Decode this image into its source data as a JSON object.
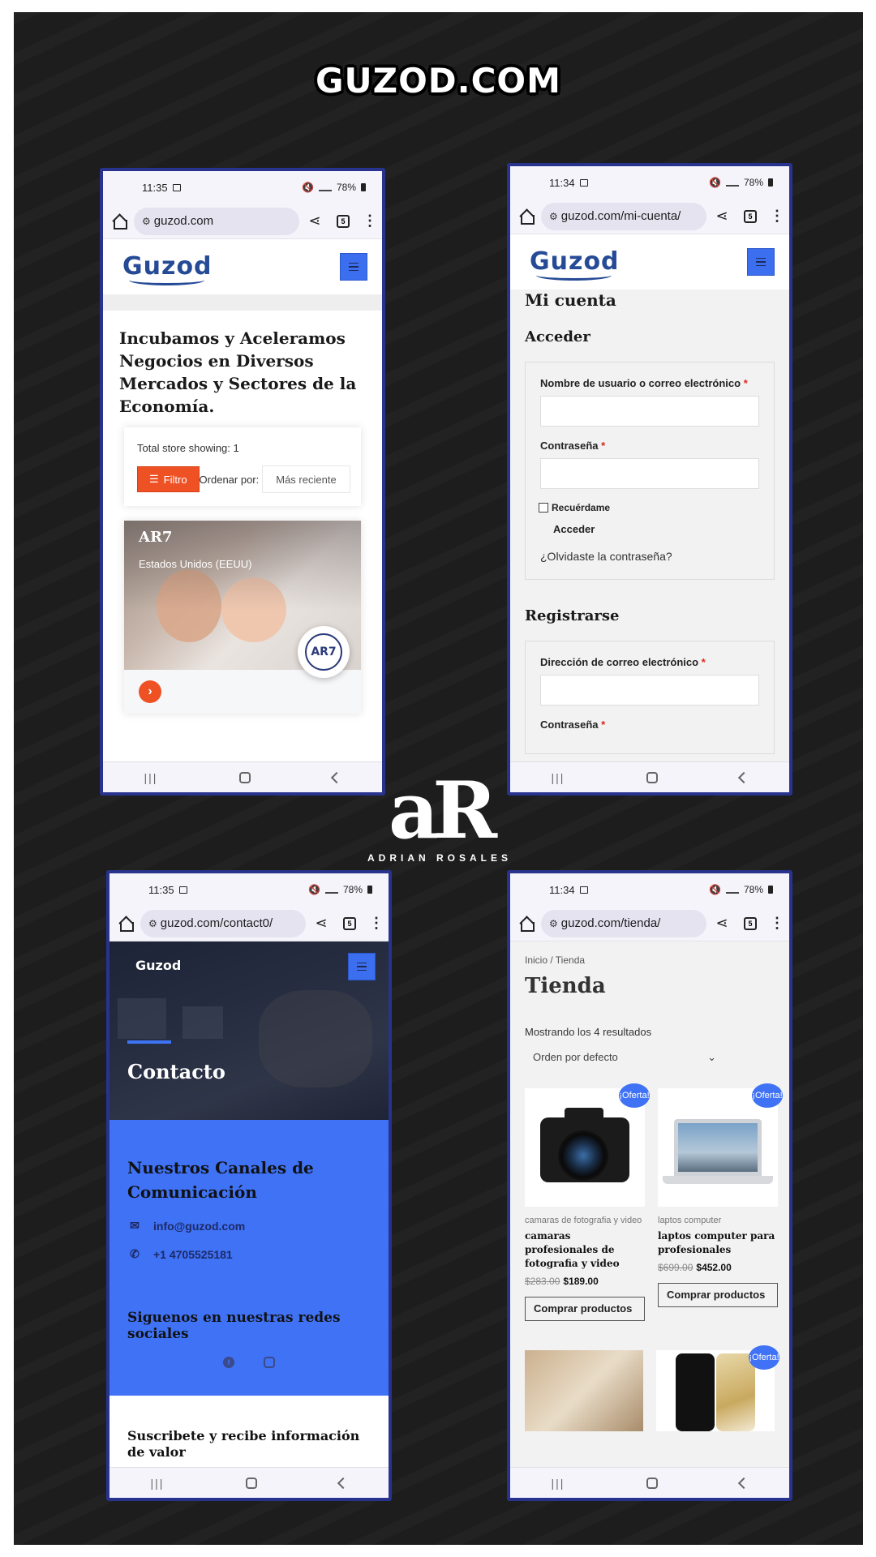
{
  "site_logo": "GUZOD.COM",
  "author_logo": {
    "mark": "aR",
    "name": "ADRIAN ROSALES"
  },
  "brand_name": "Guzod",
  "colors": {
    "background": "#1d1d1d",
    "frame": "#27338c",
    "accent_blue": "#3f72f5",
    "accent_orange": "#ee5124"
  },
  "phones": {
    "home": {
      "time": "11:35",
      "battery": "78%",
      "url": "guzod.com",
      "tab_count": "5",
      "hero_title": "Incubamos y Aceleramos Negocios en Diversos Mercados y Sectores de la Economía.",
      "store_count": "Total store showing: 1",
      "filter_label": "Filtro",
      "order_label": "Ordenar por:",
      "order_value": "Más reciente",
      "store_name": "AR7",
      "store_location": "Estados Unidos (EEUU)",
      "store_badge": "AR7"
    },
    "account": {
      "time": "11:34",
      "battery": "78%",
      "url": "guzod.com/mi-cuenta/",
      "tab_count": "5",
      "page_title": "Mi cuenta",
      "login_heading": "Acceder",
      "username_label": "Nombre de usuario o correo electrónico",
      "password_label": "Contraseña",
      "required_mark": "*",
      "remember_label": "Recuérdame",
      "login_button": "Acceder",
      "forgot_link": "¿Olvidaste la contraseña?",
      "register_heading": "Registrarse",
      "email_label": "Dirección de correo electrónico",
      "password_label_2": "Contraseña"
    },
    "contact": {
      "time": "11:35",
      "battery": "78%",
      "url": "guzod.com/contact0/",
      "tab_count": "5",
      "hero_title": "Contacto",
      "channels_heading": "Nuestros Canales de Comunicación",
      "email": "info@guzod.com",
      "phone": "+1 4705525181",
      "social_heading": "Siguenos en nuestras redes sociales",
      "subscribe_heading": "Suscribete y recibe información de valor"
    },
    "shop": {
      "time": "11:34",
      "battery": "78%",
      "url": "guzod.com/tienda/",
      "tab_count": "5",
      "breadcrumb": "Inicio / Tienda",
      "page_title": "Tienda",
      "results": "Mostrando los 4 resultados",
      "sort": "Orden por defecto",
      "sale_badge": "¡Oferta!",
      "products": [
        {
          "category": "camaras de fotografia y video",
          "name": "camaras profesionales de fotografia y video",
          "old_price": "$283.00",
          "price": "$189.00",
          "button": "Comprar productos"
        },
        {
          "category": "laptos computer",
          "name": "laptos computer para profesionales",
          "old_price": "$699.00",
          "price": "$452.00",
          "button": "Comprar productos"
        }
      ]
    }
  }
}
